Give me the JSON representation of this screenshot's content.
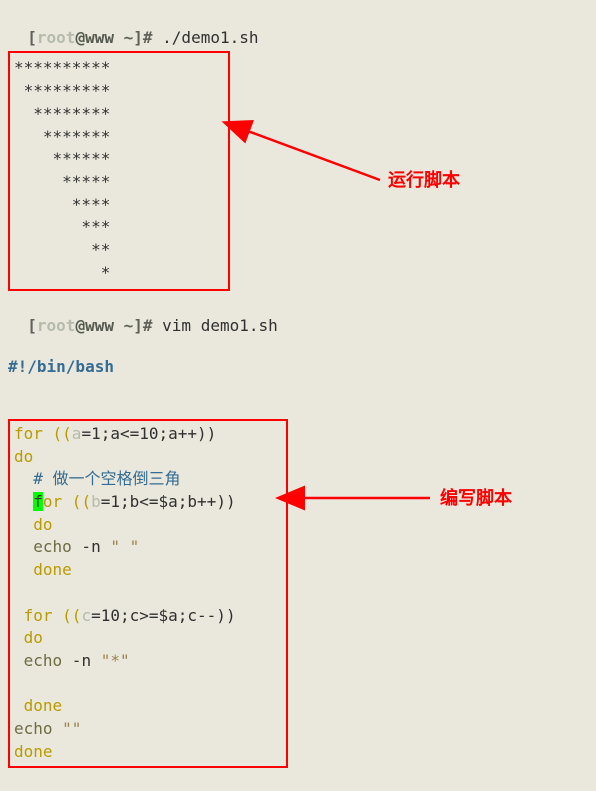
{
  "prompt1": {
    "lbracket": "[",
    "user": "root",
    "at": "@",
    "host": "www",
    "dir": " ~",
    "rbracket": "]",
    "hash": "#",
    "command": " ./demo1.sh"
  },
  "output_lines": [
    "**********",
    " *********",
    "  ********",
    "   *******",
    "    ******",
    "     *****",
    "      ****",
    "       ***",
    "        **",
    "         *"
  ],
  "prompt2": {
    "lbracket": "[",
    "user": "root",
    "at": "@",
    "host": "www",
    "dir": " ~",
    "rbracket": "]",
    "hash": "#",
    "command": " vim demo1.sh"
  },
  "shebang": "#!/bin/bash",
  "code": {
    "for1_open": "for ((",
    "for1_var": "a",
    "for1_rest": "=1;a<=10;a++))",
    "do": "do",
    "comment": "  # 做一个空格倒三角",
    "for2_indent": "  ",
    "for2_cursor": "f",
    "for2_after": "or ((",
    "for2_var": "b",
    "for2_rest": "=1;b<=$a;b++))",
    "do2": "  do",
    "echo1_kw": "  echo",
    "echo1_flag": " -n ",
    "echo1_str": "\" \"",
    "done2": "  done",
    "for3_open": " for ((",
    "for3_var": "c",
    "for3_rest": "=10;c>=$a;c--))",
    "do3": " do",
    "echo2_kw": " echo",
    "echo2_flag": " -n ",
    "echo2_str": "\"*\"",
    "done3": " done",
    "echo3_kw": "echo",
    "echo3_str": " \"\"",
    "done1": "done"
  },
  "annotations": {
    "run": "运行脚本",
    "write": "编写脚本"
  }
}
